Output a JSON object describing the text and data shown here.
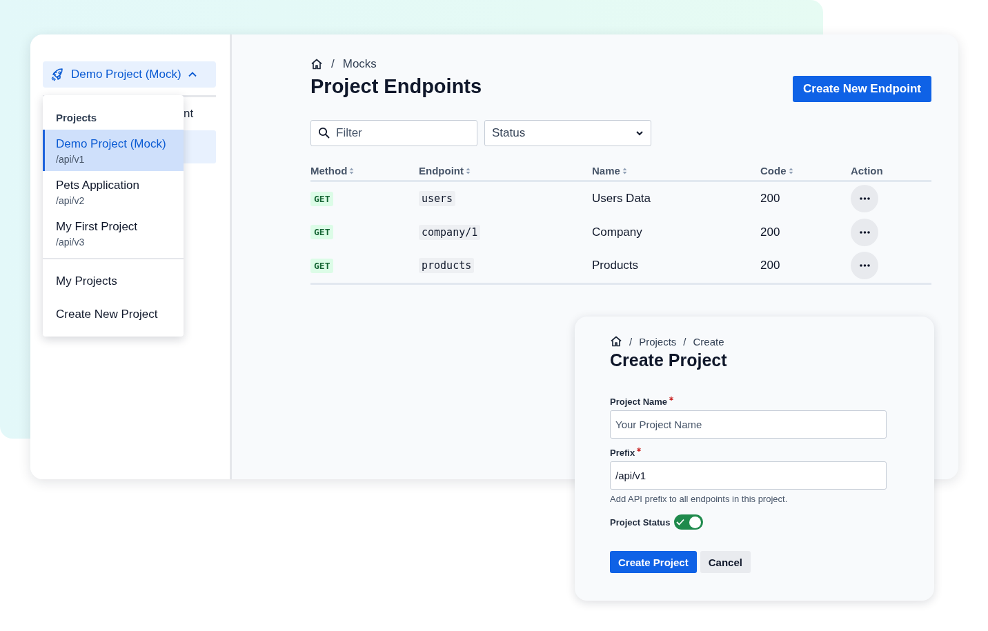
{
  "project_switcher": {
    "label": "Demo Project (Mock)",
    "expanded": true
  },
  "sidebar": {
    "items": [
      {
        "label": "nt",
        "selected": false
      },
      {
        "selected": true
      }
    ]
  },
  "project_menu": {
    "heading": "Projects",
    "projects": [
      {
        "name": "Demo Project (Mock)",
        "prefix": "/api/v1",
        "selected": true
      },
      {
        "name": "Pets Application",
        "prefix": "/api/v2",
        "selected": false
      },
      {
        "name": "My First Project",
        "prefix": "/api/v3",
        "selected": false
      }
    ],
    "links": [
      "My Projects",
      "Create New Project"
    ]
  },
  "page": {
    "breadcrumb": {
      "separator": "/",
      "items": [
        "Mocks"
      ]
    },
    "title": "Project Endpoints",
    "primary_button": "Create New Endpoint",
    "filter": {
      "placeholder": "Filter"
    },
    "status_select": {
      "placeholder": "Status"
    }
  },
  "table": {
    "columns": [
      {
        "label": "Method",
        "sortable": true
      },
      {
        "label": "Endpoint",
        "sortable": true
      },
      {
        "label": "Name",
        "sortable": true
      },
      {
        "label": "Code",
        "sortable": true
      },
      {
        "label": "Action",
        "sortable": false
      }
    ],
    "rows": [
      {
        "method": "GET",
        "endpoint": "users",
        "name": "Users Data",
        "code": "200"
      },
      {
        "method": "GET",
        "endpoint": "company/1",
        "name": "Company",
        "code": "200"
      },
      {
        "method": "GET",
        "endpoint": "products",
        "name": "Products",
        "code": "200"
      }
    ]
  },
  "create_project": {
    "breadcrumb": {
      "separator": "/",
      "items": [
        "Projects",
        "Create"
      ]
    },
    "title": "Create Project",
    "fields": [
      {
        "label": "Project Name",
        "required": true,
        "placeholder": "Your Project Name"
      },
      {
        "label": "Prefix",
        "required": true,
        "value": "/api/v1",
        "help": "Add API prefix to all endpoints in this project."
      }
    ],
    "status": {
      "label": "Project Status",
      "on": true
    },
    "buttons": [
      {
        "label": "Create Project",
        "kind": "primary"
      },
      {
        "label": "Cancel",
        "kind": "secondary"
      }
    ]
  }
}
